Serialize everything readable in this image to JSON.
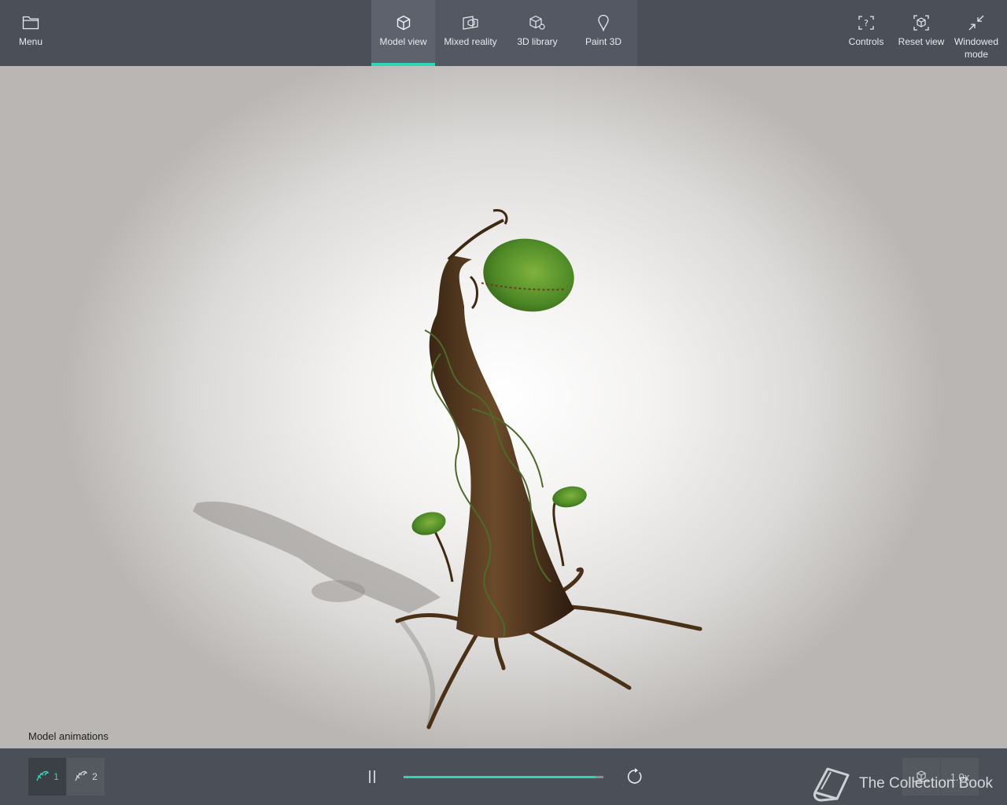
{
  "topbar": {
    "menu_label": "Menu",
    "tabs": [
      {
        "label": "Model view",
        "icon": "cube-icon",
        "active": true
      },
      {
        "label": "Mixed reality",
        "icon": "mixed-reality-icon",
        "active": false
      },
      {
        "label": "3D library",
        "icon": "library-icon",
        "active": false
      },
      {
        "label": "Paint 3D",
        "icon": "paint-3d-icon",
        "active": false
      }
    ],
    "controls_label": "Controls",
    "reset_label": "Reset view",
    "windowed_label": "Windowed mode"
  },
  "viewport": {
    "model": "carnivorous plant 3D model"
  },
  "animations": {
    "label": "Model animations",
    "items": [
      {
        "label": "1",
        "active": true
      },
      {
        "label": "2",
        "active": false
      }
    ],
    "progress": 0.96
  },
  "bottom_right": {
    "speed_label": "1.0x",
    "watermark_text": "The Collection Book"
  },
  "colors": {
    "accent": "#2ed6b6",
    "bar": "#4a4f58"
  }
}
